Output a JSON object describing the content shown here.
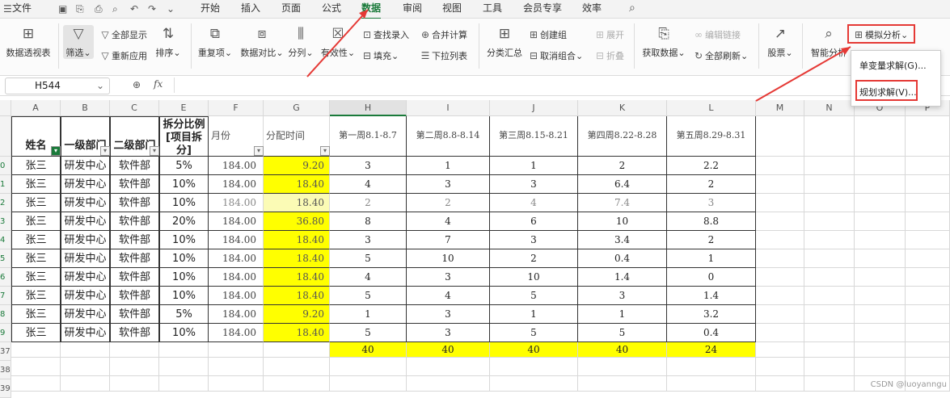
{
  "menubar": {
    "file": "文件",
    "tabs": [
      "开始",
      "插入",
      "页面",
      "公式",
      "数据",
      "审阅",
      "视图",
      "工具",
      "会员专享",
      "效率"
    ],
    "active_tab": "数据"
  },
  "ribbon": {
    "pivot": "数据透视表",
    "filter": "筛选",
    "show_all": "全部显示",
    "reapply": "重新应用",
    "sort": "排序",
    "duplicates": "重复项",
    "compare": "数据对比",
    "split": "分列",
    "validity": "有效性",
    "lookup_entry": "查找录入",
    "fill": "填充",
    "consolidate": "合并计算",
    "dropdown_list": "下拉列表",
    "subtotal": "分类汇总",
    "create_group": "创建组",
    "ungroup": "取消组合",
    "expand": "展开",
    "collapse": "折叠",
    "get_data": "获取数据",
    "edit_links": "编辑链接",
    "refresh_all": "全部刷新",
    "stocks": "股票",
    "smart_analysis": "智能分析",
    "what_if": "模拟分析"
  },
  "formula_bar": {
    "name_box": "H544",
    "fx": "fx"
  },
  "dropdown": {
    "items": [
      "单变量求解(G)...",
      "规划求解(V)..."
    ]
  },
  "sheet": {
    "columns": [
      "A",
      "B",
      "C",
      "E",
      "F",
      "G",
      "H",
      "I",
      "J",
      "K",
      "L",
      "M",
      "N",
      "O",
      "P"
    ],
    "header_row": [
      "姓名",
      "一级部门",
      "二级部门",
      "拆分比例[项目拆分]",
      "月份",
      "分配时间",
      "第一周8.1-8.7",
      "第二周8.8-8.14",
      "第三周8.15-8.21",
      "第四周8.22-8.28",
      "第五周8.29-8.31"
    ],
    "row_numbers": [
      "0",
      "1",
      "2",
      "3",
      "4",
      "5",
      "6",
      "7",
      "8",
      "9",
      "37",
      "38",
      "39"
    ],
    "rows": [
      [
        "张三",
        "研发中心",
        "软件部",
        "5%",
        "184.00",
        "9.20",
        "3",
        "1",
        "1",
        "2",
        "2.2"
      ],
      [
        "张三",
        "研发中心",
        "软件部",
        "10%",
        "184.00",
        "18.40",
        "4",
        "3",
        "3",
        "6.4",
        "2"
      ],
      [
        "张三",
        "研发中心",
        "软件部",
        "10%",
        "184.00",
        "18.40",
        "2",
        "2",
        "4",
        "7.4",
        "3"
      ],
      [
        "张三",
        "研发中心",
        "软件部",
        "20%",
        "184.00",
        "36.80",
        "8",
        "4",
        "6",
        "10",
        "8.8"
      ],
      [
        "张三",
        "研发中心",
        "软件部",
        "10%",
        "184.00",
        "18.40",
        "3",
        "7",
        "3",
        "3.4",
        "2"
      ],
      [
        "张三",
        "研发中心",
        "软件部",
        "10%",
        "184.00",
        "18.40",
        "5",
        "10",
        "2",
        "0.4",
        "1"
      ],
      [
        "张三",
        "研发中心",
        "软件部",
        "10%",
        "184.00",
        "18.40",
        "4",
        "3",
        "10",
        "1.4",
        "0"
      ],
      [
        "张三",
        "研发中心",
        "软件部",
        "10%",
        "184.00",
        "18.40",
        "5",
        "4",
        "5",
        "3",
        "1.4"
      ],
      [
        "张三",
        "研发中心",
        "软件部",
        "5%",
        "184.00",
        "9.20",
        "1",
        "3",
        "1",
        "1",
        "3.2"
      ],
      [
        "张三",
        "研发中心",
        "软件部",
        "10%",
        "184.00",
        "18.40",
        "5",
        "3",
        "5",
        "5",
        "0.4"
      ]
    ],
    "totals": [
      "40",
      "40",
      "40",
      "40",
      "24"
    ]
  },
  "watermark": "CSDN @luoyanngu",
  "colors": {
    "accent": "#1a7a3a",
    "highlight": "#ffff00",
    "annotation": "#e53935"
  }
}
